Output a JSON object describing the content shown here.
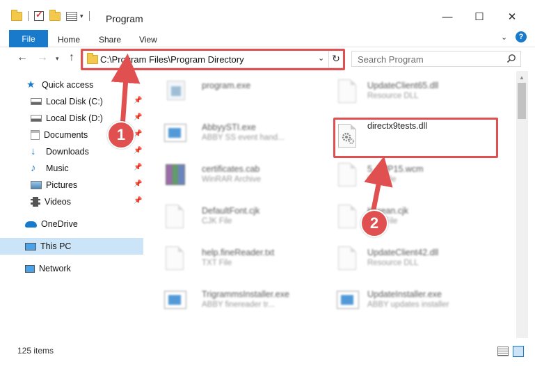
{
  "window": {
    "title": "Program",
    "controls": {
      "minimize": "—",
      "maximize": "☐",
      "close": "✕"
    }
  },
  "ribbon": {
    "tabs": [
      "File",
      "Home",
      "Share",
      "View"
    ]
  },
  "address_bar": {
    "path": "C:\\Program Files\\Program Directory"
  },
  "search": {
    "placeholder": "Search Program"
  },
  "sidebar": {
    "items": [
      {
        "label": "Quick access",
        "icon": "star-icon"
      },
      {
        "label": "Local Disk (C:)",
        "icon": "drive-icon",
        "pinned": true
      },
      {
        "label": "Local Disk (D:)",
        "icon": "drive-icon",
        "pinned": true
      },
      {
        "label": "Documents",
        "icon": "documents-icon",
        "pinned": true
      },
      {
        "label": "Downloads",
        "icon": "download-icon",
        "pinned": true
      },
      {
        "label": "Music",
        "icon": "music-icon",
        "pinned": true
      },
      {
        "label": "Pictures",
        "icon": "pictures-icon",
        "pinned": true
      },
      {
        "label": "Videos",
        "icon": "video-icon",
        "pinned": true
      },
      {
        "label": "OneDrive",
        "icon": "cloud-icon"
      },
      {
        "label": "This PC",
        "icon": "computer-icon",
        "selected": true
      },
      {
        "label": "Network",
        "icon": "network-icon"
      }
    ]
  },
  "files": [
    {
      "name": "program.exe",
      "desc": ""
    },
    {
      "name": "UpdateClient65.dll",
      "desc": "Resource DLL"
    },
    {
      "name": "AbbyySTI.exe",
      "desc": "ABBY SS event hand..."
    },
    {
      "name": "directx9tests.dll",
      "desc": ""
    },
    {
      "name": "certificates.cab",
      "desc": "WinRAR Archive"
    },
    {
      "name": "5...WP15.wcm",
      "desc": "W... File"
    },
    {
      "name": "DefaultFont.cjk",
      "desc": "CJK File"
    },
    {
      "name": "Korean.cjk",
      "desc": "CJK File"
    },
    {
      "name": "help.fineReader.txt",
      "desc": "TXT File"
    },
    {
      "name": "UpdateClient42.dll",
      "desc": "Resource DLL"
    },
    {
      "name": "TrigrammsInstaller.exe",
      "desc": "ABBY finereader tr..."
    },
    {
      "name": "UpdateInstaller.exe",
      "desc": "ABBY updates installer"
    }
  ],
  "status": {
    "item_count": "125 items"
  },
  "annotations": {
    "step1": "1",
    "step2": "2"
  },
  "colors": {
    "accent": "#1979ca",
    "highlight": "#e05050",
    "selected_bg": "#cce4f7"
  }
}
